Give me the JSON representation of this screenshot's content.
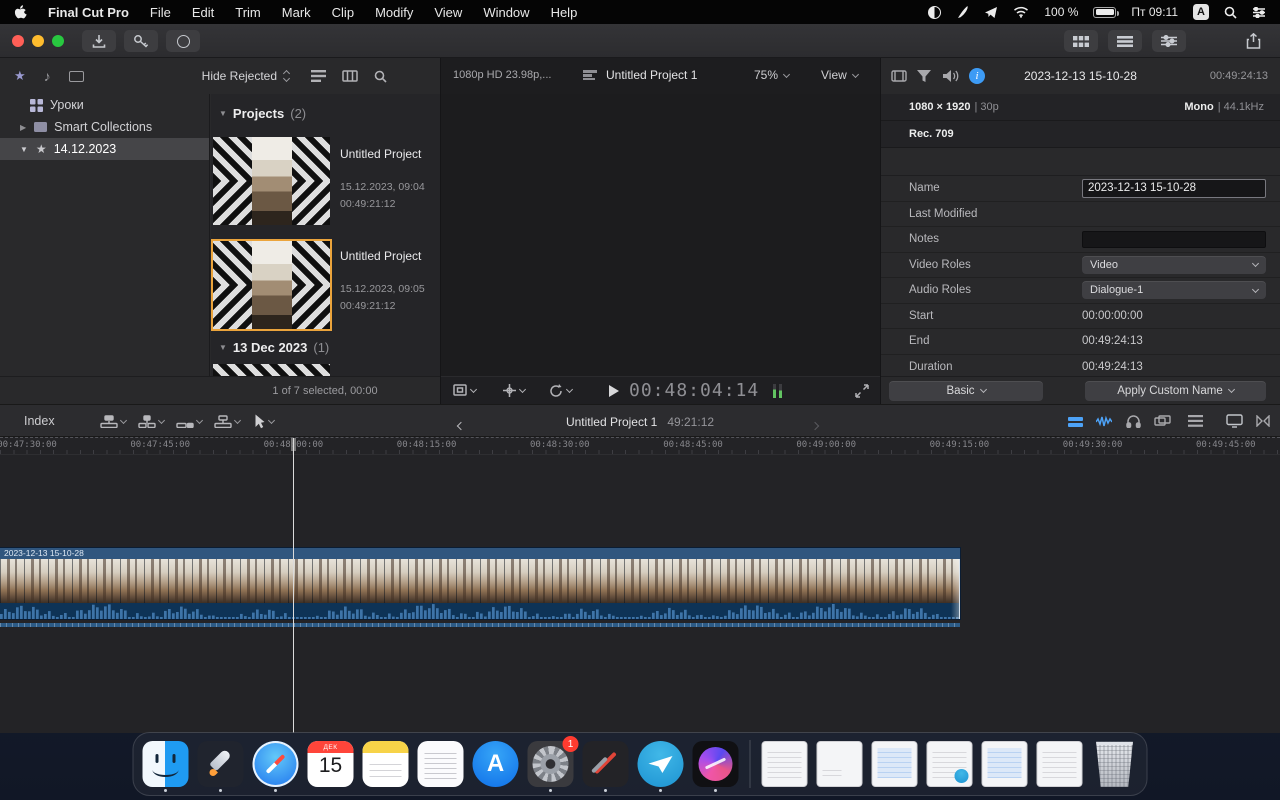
{
  "menubar": {
    "app_name": "Final Cut Pro",
    "menus": [
      "File",
      "Edit",
      "Trim",
      "Mark",
      "Clip",
      "Modify",
      "View",
      "Window",
      "Help"
    ],
    "battery_label": "100 %",
    "clock": "Пт 09:11",
    "input_badge": "A"
  },
  "sidebar": {
    "library": "Уроки",
    "smart_collections": "Smart Collections",
    "event": "14.12.2023"
  },
  "browser": {
    "filter_label": "Hide Rejected",
    "projects_section": {
      "title": "Projects",
      "count": "(2)"
    },
    "date_section": {
      "title": "13 Dec 2023",
      "count": "(1)"
    },
    "projects": [
      {
        "name": "Untitled Project",
        "date": "15.12.2023, 09:04",
        "duration": "00:49:21:12"
      },
      {
        "name": "Untitled Project",
        "date": "15.12.2023, 09:05",
        "duration": "00:49:21:12"
      }
    ],
    "status": "1 of 7 selected, 00:00"
  },
  "viewer": {
    "format": "1080p HD 23.98p,...",
    "title": "Untitled Project 1",
    "zoom": "75%",
    "view_label": "View",
    "timecode": "00:48:04:14"
  },
  "inspector": {
    "title": "2023-12-13 15-10-28",
    "duration": "00:49:24:13",
    "video_format_bold": "1080 × 1920",
    "video_format_dim": "| 30p",
    "audio_format_bold": "Mono",
    "audio_format_dim": "| 44.1kHz",
    "color_space": "Rec. 709",
    "fields": {
      "name": {
        "label": "Name",
        "value": "2023-12-13 15-10-28"
      },
      "last_modified": {
        "label": "Last Modified",
        "value": ""
      },
      "notes": {
        "label": "Notes",
        "value": ""
      },
      "video_roles": {
        "label": "Video Roles",
        "value": "Video"
      },
      "audio_roles": {
        "label": "Audio Roles",
        "value": "Dialogue-1"
      },
      "start": {
        "label": "Start",
        "value": "00:00:00:00"
      },
      "end": {
        "label": "End",
        "value": "00:49:24:13"
      },
      "duration": {
        "label": "Duration",
        "value": "00:49:24:13"
      }
    },
    "footer": {
      "basic": "Basic",
      "apply": "Apply Custom Name"
    }
  },
  "timeline": {
    "index_label": "Index",
    "project": "Untitled Project 1",
    "project_timecode": "49:21:12",
    "ruler": [
      "00:47:30:00",
      "00:47:45:00",
      "00:48:00:00",
      "00:48:15:00",
      "00:48:30:00",
      "00:48:45:00",
      "00:49:00:00",
      "00:49:15:00",
      "00:49:30:00",
      "00:49:45:00"
    ],
    "clip_name": "2023-12-13 15-10-28"
  },
  "dock": {
    "calendar": {
      "month": "ДЕК",
      "day": "15"
    },
    "items": [
      {
        "id": "finder",
        "running": true
      },
      {
        "id": "rocket",
        "running": true
      },
      {
        "id": "safari",
        "running": true
      },
      {
        "id": "calendar"
      },
      {
        "id": "notes"
      },
      {
        "id": "textedit"
      },
      {
        "id": "appstore"
      },
      {
        "id": "settings",
        "badge": "1",
        "running": true
      },
      {
        "id": "darkapp",
        "running": true
      },
      {
        "id": "telegram",
        "running": true
      },
      {
        "id": "fcp",
        "running": true
      },
      {
        "type": "sep"
      },
      {
        "id": "window",
        "variant": "a"
      },
      {
        "id": "window",
        "variant": "b"
      },
      {
        "id": "window",
        "variant": "c"
      },
      {
        "id": "window",
        "variant": "d"
      },
      {
        "id": "window",
        "variant": "c"
      },
      {
        "id": "window",
        "variant": "a"
      },
      {
        "id": "trash"
      }
    ]
  }
}
